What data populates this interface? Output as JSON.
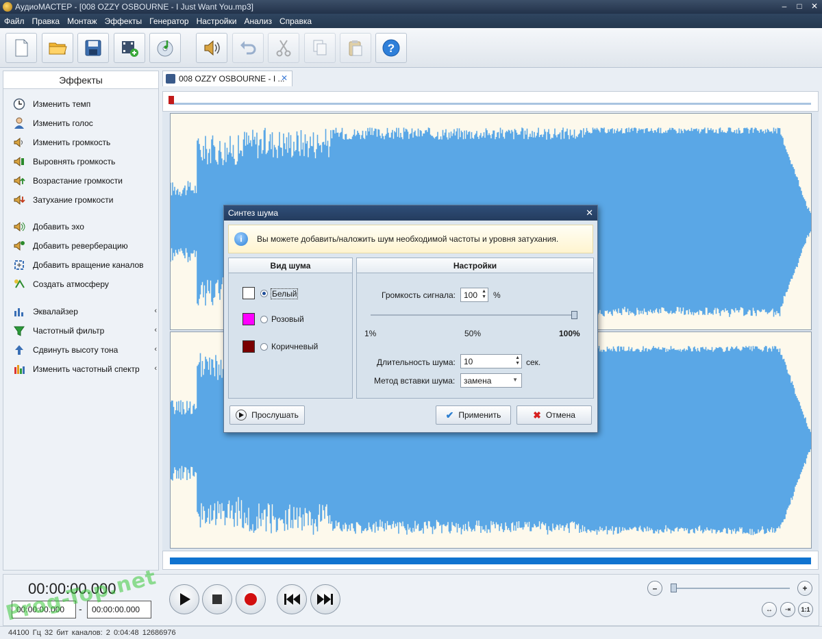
{
  "window": {
    "title": "АудиоМАСТЕР - [008 OZZY OSBOURNE - I Just Want You.mp3]",
    "min": "–",
    "max": "□",
    "close": "✕"
  },
  "menu": [
    "Файл",
    "Правка",
    "Монтаж",
    "Эффекты",
    "Генератор",
    "Настройки",
    "Анализ",
    "Справка"
  ],
  "toolbar": {
    "icons": [
      "new-file-icon",
      "open-folder-icon",
      "save-icon",
      "add-video-icon",
      "cd-music-icon",
      "speaker-icon",
      "undo-icon",
      "cut-icon",
      "copy-icon",
      "paste-icon",
      "help-icon"
    ]
  },
  "sidebar": {
    "header": "Эффекты",
    "items": [
      {
        "label": "Изменить темп",
        "icon": "clock-icon"
      },
      {
        "label": "Изменить голос",
        "icon": "person-icon"
      },
      {
        "label": "Изменить громкость",
        "icon": "speaker-volume-icon"
      },
      {
        "label": "Выровнять громкость",
        "icon": "speaker-level-icon"
      },
      {
        "label": "Возрастание громкости",
        "icon": "speaker-up-icon"
      },
      {
        "label": "Затухание громкости",
        "icon": "speaker-down-icon"
      },
      {
        "label": "Добавить эхо",
        "icon": "echo-icon"
      },
      {
        "label": "Добавить реверберацию",
        "icon": "reverb-icon"
      },
      {
        "label": "Добавить вращение каналов",
        "icon": "rotate-channels-icon"
      },
      {
        "label": "Создать атмосферу",
        "icon": "atmosphere-icon"
      },
      {
        "label": "Эквалайзер",
        "icon": "equalizer-icon",
        "arrow": "‹"
      },
      {
        "label": "Частотный фильтр",
        "icon": "filter-icon",
        "arrow": "‹"
      },
      {
        "label": "Сдвинуть высоту тона",
        "icon": "pitch-icon",
        "arrow": "‹"
      },
      {
        "label": "Изменить частотный спектр",
        "icon": "spectrum-icon",
        "arrow": "‹"
      }
    ]
  },
  "tab": {
    "label": "008 OZZY OSBOURNE - I ...",
    "close": "✕"
  },
  "dialog": {
    "title": "Синтез шума",
    "close": "✕",
    "info": "Вы можете добавить/наложить шум необходимой частоты и уровня затухания.",
    "info_icon": "i",
    "noise_group": {
      "header": "Вид шума",
      "options": [
        {
          "label": "Белый",
          "color": "#ffffff",
          "selected": true
        },
        {
          "label": "Розовый",
          "color": "#ff00ff",
          "selected": false
        },
        {
          "label": "Коричневый",
          "color": "#7a0000",
          "selected": false
        }
      ]
    },
    "settings_group": {
      "header": "Настройки",
      "volume_label": "Громкость сигнала:",
      "volume_value": "100",
      "volume_unit": "%",
      "slider_level_percent": 100,
      "slider_ticks": [
        "1%",
        "50%",
        "100%"
      ],
      "duration_label": "Длительность шума:",
      "duration_value": "10",
      "duration_unit": "сек.",
      "method_label": "Метод вставки шума:",
      "method_value": "замена"
    },
    "buttons": {
      "listen": "Прослушать",
      "apply": "Применить",
      "cancel": "Отмена"
    }
  },
  "transport": {
    "current_time": "00:00:00.000",
    "range_start": "00:00:00.000",
    "range_sep": "-",
    "range_end": "00:00:00.000"
  },
  "zoom": {
    "minus": "–",
    "plus": "+",
    "fit": "1:1"
  },
  "status": "44100 Гц   32 бит   каналов: 2   0:04:48 12686976",
  "watermark": "Prog-Top.net",
  "colors": {
    "wave": "#5aa7e6",
    "wave_bg": "#fdf9ec",
    "accent": "#0f73d0"
  }
}
